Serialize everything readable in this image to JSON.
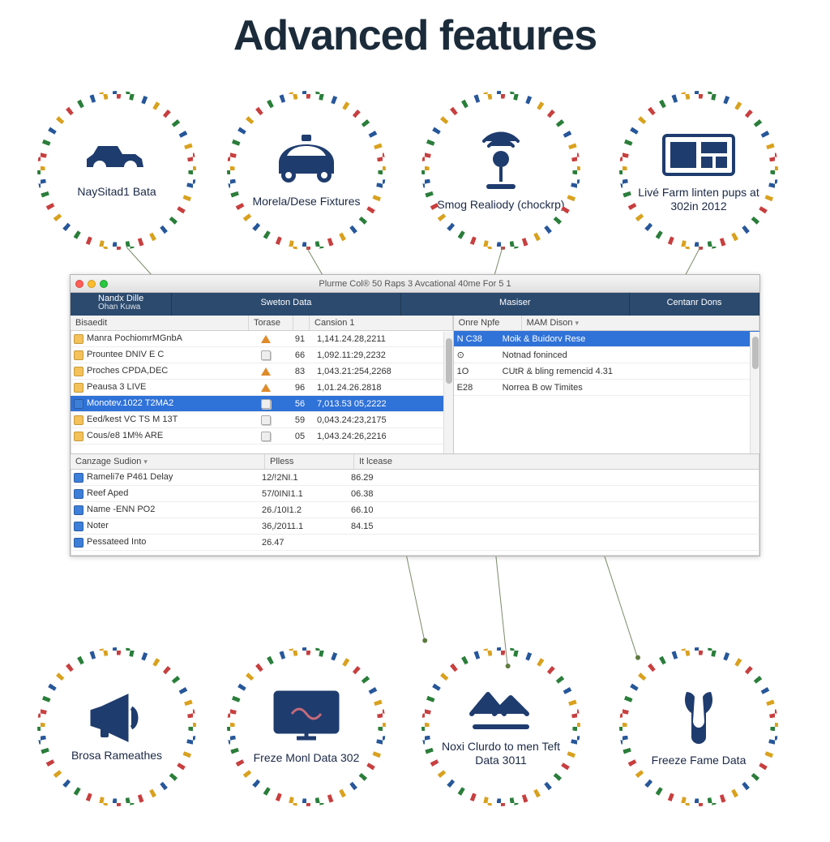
{
  "title": "Advanced features",
  "topFeatures": [
    {
      "label": "NaySitad1 Bata"
    },
    {
      "label": "Morela/Dese Fixtures"
    },
    {
      "label": "Smog Realiody (chockrp)"
    },
    {
      "label": "Livé Farm linten pups at 302in 2012"
    }
  ],
  "bottomFeatures": [
    {
      "label": "Brosa Rameathes"
    },
    {
      "label": "Freze Monl Data 302"
    },
    {
      "label": "Noxi Clurdo to men Teft Data 3011"
    },
    {
      "label": "Freeze Fame Data"
    }
  ],
  "window": {
    "title": "Plurme Col® 50 Raps 3 Avcational 40me For 5 1",
    "tabs": [
      {
        "top": "Nandx Dille",
        "bottom": "Ohan Kuwa"
      },
      {
        "top": "Sweton Data",
        "bottom": ""
      },
      {
        "top": "Masiser",
        "bottom": ""
      },
      {
        "top": "Centanr Dons",
        "bottom": ""
      }
    ],
    "leftPane": {
      "headers": [
        "Bisaedit",
        "Torase",
        "",
        "Cansion 1"
      ],
      "rows": [
        {
          "icon": "doc",
          "c1": "Manra PochiomrMGnbA",
          "warn": true,
          "c3": "91",
          "c4": "1,141.24.28,2211"
        },
        {
          "icon": "doc",
          "c1": "Prountee DNIV E C",
          "warn": false,
          "c3": "66",
          "c4": "1,092.11:29,2232"
        },
        {
          "icon": "doc",
          "c1": "Proches CPDA,DEC",
          "warn": true,
          "c3": "83",
          "c4": "1,043.21:254,2268"
        },
        {
          "icon": "doc",
          "c1": "Peausa 3 LIVE",
          "warn": true,
          "c3": "96",
          "c4": "1,01.24.26.2818"
        },
        {
          "icon": "blue",
          "sel": true,
          "c1": "Monotev.1022 T2MA2",
          "warn": false,
          "c3": "56",
          "c4": "7,013.53 05,2222"
        },
        {
          "icon": "doc",
          "c1": "Eed/kest VC TS M 13T",
          "warn": false,
          "c3": "59",
          "c4": "0,043.24:23,2175"
        },
        {
          "icon": "doc",
          "c1": "Cous/e8 1M% ARE",
          "warn": false,
          "c3": "05",
          "c4": "1,043.24:26,2216"
        }
      ]
    },
    "rightPane": {
      "headers": [
        "Onre Npfe",
        "MAM Dison"
      ],
      "rows": [
        {
          "sel": true,
          "c1": "N C38",
          "c2": "Moik & Buidorv Rese"
        },
        {
          "c1": "⊙",
          "c2": "Notnad foninced"
        },
        {
          "c1": "1O",
          "c2": "CUtR & bling remencid 4.31"
        },
        {
          "c1": "E28",
          "c2": "Norrea B ow Timites"
        }
      ]
    },
    "lowerPane": {
      "headers": [
        "Canzage Sudion",
        "Plless",
        "It lcease"
      ],
      "rows": [
        {
          "c1": "Rameli7e P461 Delay",
          "c2": "12/!2NI.1",
          "c3": "86.29"
        },
        {
          "c1": "Reef Aped",
          "c2": "57/0INI1.1",
          "c3": "06.38"
        },
        {
          "c1": "Name -ENN PO2",
          "c2": "26./10I1.2",
          "c3": "66.10"
        },
        {
          "c1": "Noter",
          "c2": "36,/2011.1",
          "c3": "84.15"
        },
        {
          "c1": "Pessateed Into",
          "c2": "26.47",
          "c3": ""
        }
      ]
    }
  }
}
